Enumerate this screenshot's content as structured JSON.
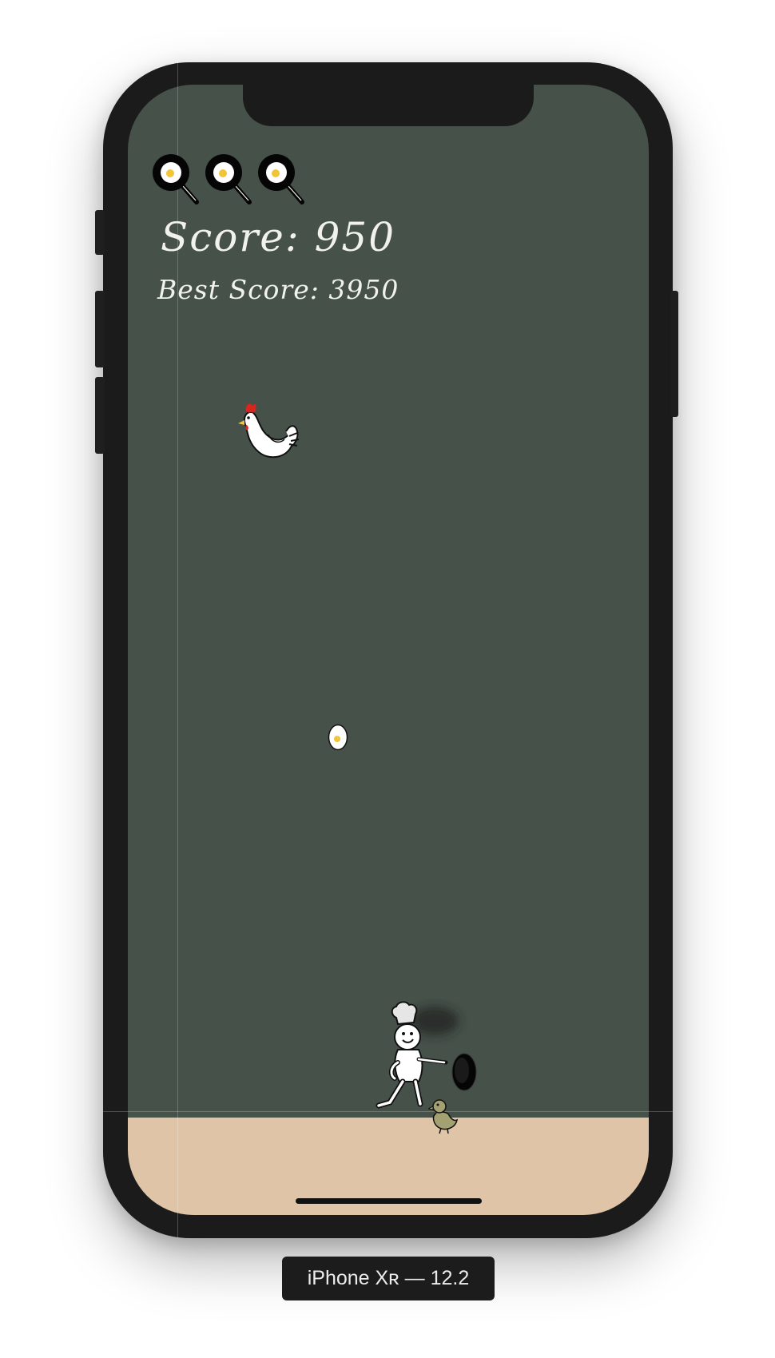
{
  "game": {
    "score_text": "Score: 950",
    "best_score_text": "Best Score: 3950",
    "lives_remaining": 3
  },
  "simulator": {
    "device_label": "iPhone Xʀ — 12.2"
  },
  "colors": {
    "background": "#455149",
    "floor": "#dfc4a7",
    "text": "#f2f2ec",
    "egg_yolk": "#f2c43a",
    "chicken_comb": "#d8261e"
  },
  "icons": [
    "frying-pan-life-icon",
    "chicken-sprite",
    "egg-sprite",
    "chef-sprite",
    "duckling-sprite"
  ]
}
